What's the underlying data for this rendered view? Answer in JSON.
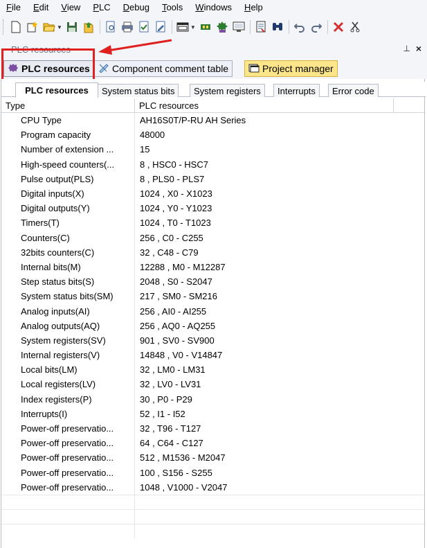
{
  "menu": [
    "File",
    "Edit",
    "View",
    "PLC",
    "Debug",
    "Tools",
    "Windows",
    "Help"
  ],
  "menu_mnemonics": [
    "F",
    "E",
    "V",
    "P",
    "D",
    "T",
    "W",
    "H"
  ],
  "panel": {
    "title": "PLC resources",
    "pin_glyph": "⊥",
    "close_glyph": "×"
  },
  "tabs": {
    "plc_resources": "PLC resources",
    "component_comment": "Component comment table",
    "project_manager": "Project manager"
  },
  "sub_tabs": [
    "PLC resources",
    "System status bits",
    "System registers",
    "Interrupts",
    "Error code"
  ],
  "table": {
    "headers": {
      "type": "Type",
      "resources": "PLC resources"
    },
    "rows": [
      {
        "type": "CPU Type",
        "value": "AH16S0T/P-RU  AH Series"
      },
      {
        "type": "Program capacity",
        "value": "48000"
      },
      {
        "type": "Number of extension ...",
        "value": "15"
      },
      {
        "type": "High-speed counters(...",
        "value": "8 ,  HSC0 - HSC7"
      },
      {
        "type": "Pulse output(PLS)",
        "value": "8 ,  PLS0 - PLS7"
      },
      {
        "type": "Digital inputs(X)",
        "value": "1024 ,  X0 - X1023"
      },
      {
        "type": "Digital outputs(Y)",
        "value": "1024 ,  Y0 - Y1023"
      },
      {
        "type": "Timers(T)",
        "value": "1024 ,  T0 - T1023"
      },
      {
        "type": "Counters(C)",
        "value": "256 ,  C0 - C255"
      },
      {
        "type": "32bits counters(C)",
        "value": "32 ,  C48 - C79"
      },
      {
        "type": "Internal bits(M)",
        "value": "12288 ,  M0 - M12287"
      },
      {
        "type": "Step status bits(S)",
        "value": "2048 ,  S0 - S2047"
      },
      {
        "type": "System status bits(SM)",
        "value": "217 ,  SM0 - SM216"
      },
      {
        "type": "Analog inputs(AI)",
        "value": "256 ,  AI0 - AI255"
      },
      {
        "type": "Analog outputs(AQ)",
        "value": "256 ,  AQ0 - AQ255"
      },
      {
        "type": "System registers(SV)",
        "value": "901 ,  SV0 - SV900"
      },
      {
        "type": "Internal registers(V)",
        "value": "14848 ,  V0 - V14847"
      },
      {
        "type": "Local bits(LM)",
        "value": "32 ,  LM0 - LM31"
      },
      {
        "type": "Local registers(LV)",
        "value": "32 ,  LV0 - LV31"
      },
      {
        "type": "Index registers(P)",
        "value": "30 ,  P0 - P29"
      },
      {
        "type": "Interrupts(I)",
        "value": "52 ,  I1 - I52"
      },
      {
        "type": "Power-off preservatio...",
        "value": "32 ,  T96 - T127"
      },
      {
        "type": "Power-off preservatio...",
        "value": "64 ,  C64 - C127"
      },
      {
        "type": "Power-off preservatio...",
        "value": "512 ,  M1536 - M2047"
      },
      {
        "type": "Power-off preservatio...",
        "value": "100 ,  S156 - S255"
      },
      {
        "type": "Power-off preservatio...",
        "value": "1048 ,  V1000 - V2047"
      }
    ]
  },
  "toolbar_icons": [
    "new-file-icon",
    "new-project-icon",
    "open-icon",
    "save-icon",
    "upload-icon",
    "print-preview-icon",
    "print-icon",
    "check-icon",
    "edit-icon",
    "window-icon",
    "connect-icon",
    "plc-icon",
    "monitor-icon",
    "compile-icon",
    "find-icon",
    "undo-icon",
    "redo-icon",
    "delete-icon",
    "cut-icon"
  ],
  "colors": {
    "highlight": "#e01f1f",
    "project_tab": "#fde68a",
    "toolbar_bg": "#f3f5f9"
  }
}
